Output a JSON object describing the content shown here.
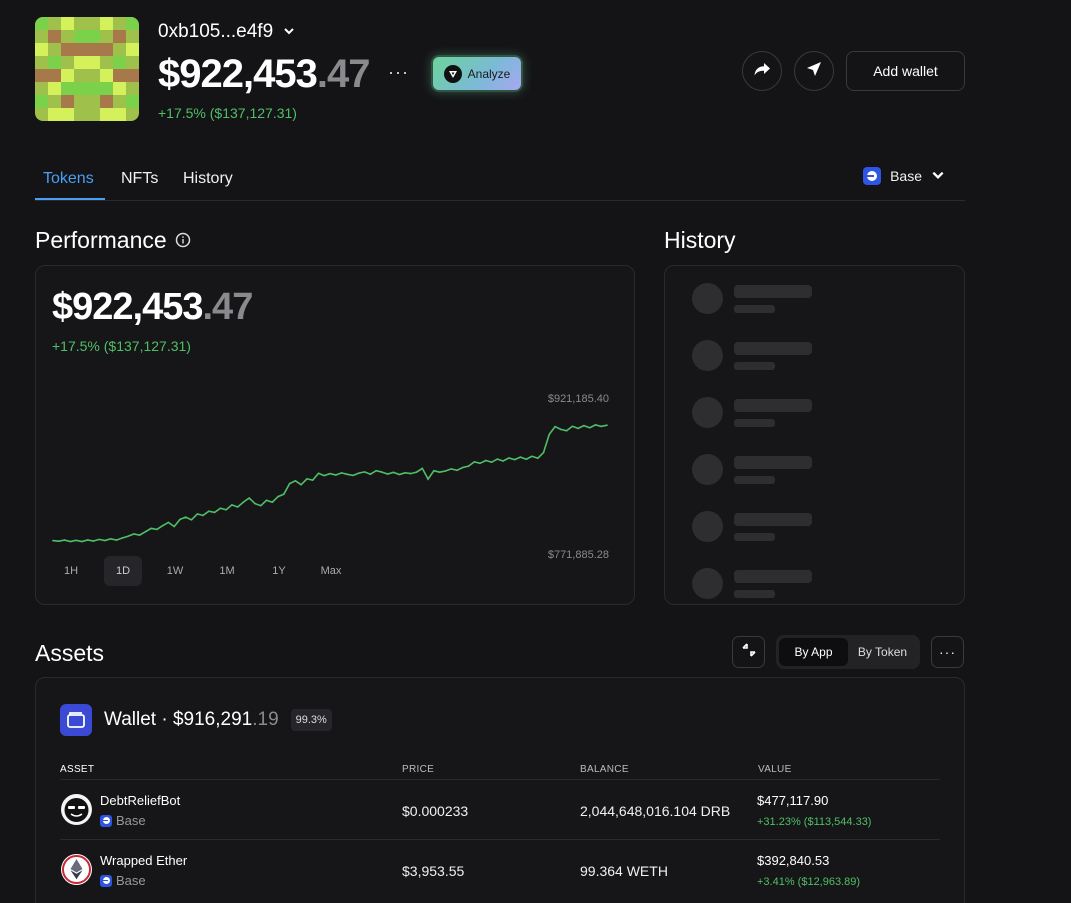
{
  "header": {
    "wallet_name": "0xb105...e4f9",
    "total_main": "$922,453",
    "total_cents": ".47",
    "change": "+17.5% ($137,127.31)",
    "analyze_label": "Analyze",
    "more_label": "···",
    "add_wallet_label": "Add wallet"
  },
  "tabs": [
    {
      "label": "Tokens",
      "active": true
    },
    {
      "label": "NFTs",
      "active": false
    },
    {
      "label": "History",
      "active": false
    }
  ],
  "network": {
    "label": "Base"
  },
  "performance": {
    "title": "Performance",
    "value_main": "$922,453",
    "value_cents": ".47",
    "change": "+17.5% ($137,127.31)",
    "high_label": "$921,185.40",
    "low_label": "$771,885.28",
    "ranges": [
      "1H",
      "1D",
      "1W",
      "1M",
      "1Y",
      "Max"
    ],
    "active_range": "1D",
    "line_color": "#4fbf67"
  },
  "chart_data": {
    "type": "line",
    "title": "",
    "xlabel": "",
    "ylabel": "",
    "ylim": [
      771885.28,
      921185.4
    ],
    "series": [
      {
        "values": [
          773500,
          772800,
          774000,
          772500,
          773800,
          772400,
          774200,
          773000,
          774800,
          773600,
          775500,
          774100,
          776500,
          778400,
          781000,
          779800,
          783500,
          787400,
          786200,
          790500,
          794200,
          789500,
          797600,
          800300,
          797200,
          803800,
          802200,
          807000,
          805600,
          810400,
          808600,
          814200,
          811800,
          817400,
          822000,
          815600,
          813200,
          819400,
          817200,
          823600,
          826400,
          838400,
          841600,
          837200,
          843800,
          842400,
          850200,
          847600,
          849800,
          848200,
          850600,
          849000,
          847800,
          850400,
          851800,
          849200,
          853200,
          851600,
          849400,
          851200,
          848800,
          850800,
          849800,
          851600,
          855800,
          843600,
          853200,
          851400,
          852800,
          855200,
          853600,
          856800,
          858400,
          863200,
          861600,
          864800,
          862800,
          866400,
          864200,
          867600,
          865800,
          868600,
          866200,
          869600,
          867400,
          873800,
          894600,
          903400,
          900200,
          898600,
          903800,
          901400,
          904600,
          902200,
          905400,
          903600,
          905000
        ]
      }
    ]
  },
  "history": {
    "title": "History",
    "skeleton_rows": 6
  },
  "assets": {
    "title": "Assets",
    "toggle": [
      "By App",
      "By Token"
    ],
    "active_toggle": "By App",
    "more_label": "···",
    "wallet_label": "Wallet · $916,291",
    "wallet_cents": ".19",
    "wallet_pct": "99.3%",
    "columns": [
      "ASSET",
      "PRICE",
      "BALANCE",
      "VALUE"
    ],
    "rows": [
      {
        "name": "DebtReliefBot",
        "network": "Base",
        "price": "$0.000233",
        "balance": "2,044,648,016.104 DRB",
        "value": "$477,117.90",
        "change": "+31.23% ($113,544.33)",
        "icon": "debtreliefbot-icon"
      },
      {
        "name": "Wrapped Ether",
        "network": "Base",
        "price": "$3,953.55",
        "balance": "99.364 WETH",
        "value": "$392,840.53",
        "change": "+3.41% ($12,963.89)",
        "icon": "ethereum-icon"
      }
    ]
  }
}
